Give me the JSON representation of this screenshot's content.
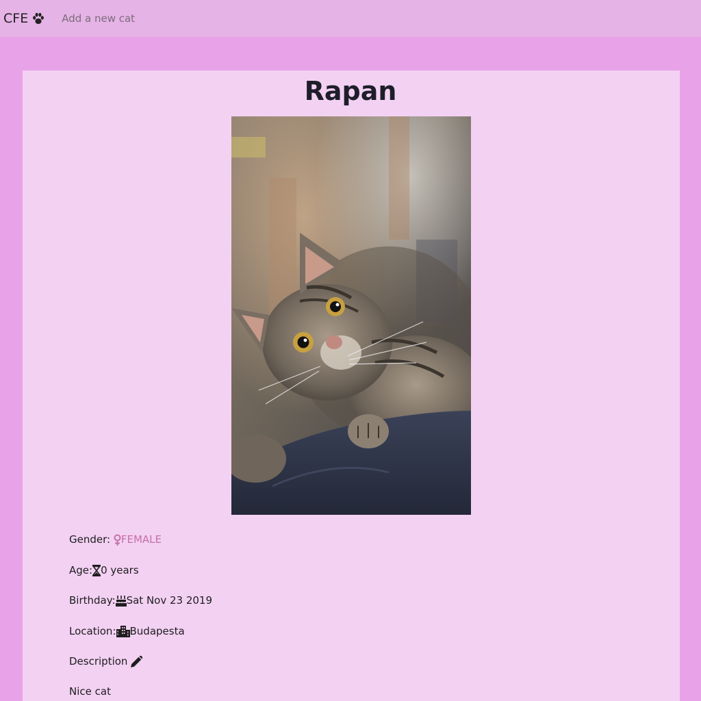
{
  "navbar": {
    "brand": "CFE",
    "brand_icon": "paw-icon",
    "add_link": "Add a new cat"
  },
  "cat": {
    "name": "Rapan",
    "photo_alt": "Tabby cat peeking over a dark blue cushion",
    "gender_label": "Gender:",
    "gender_value": "FEMALE",
    "gender_icon": "female-icon",
    "age_label": "Age:",
    "age_value": " 0 years",
    "age_icon": "hourglass-icon",
    "birthday_label": "Birthday:",
    "birthday_value": " Sat Nov 23 2019",
    "birthday_icon": "birthday-cake-icon",
    "location_label": "Location: ",
    "location_value": "Budapesta",
    "location_icon": "city-icon",
    "description_label": "Description ",
    "description_icon": "pencil-icon",
    "description_value": "Nice cat"
  },
  "colors": {
    "page_background": "#e8a3e8",
    "navbar_background": "#e6b3e6",
    "card_background": "#f3d1f3",
    "gender_accent": "#c470a8"
  }
}
